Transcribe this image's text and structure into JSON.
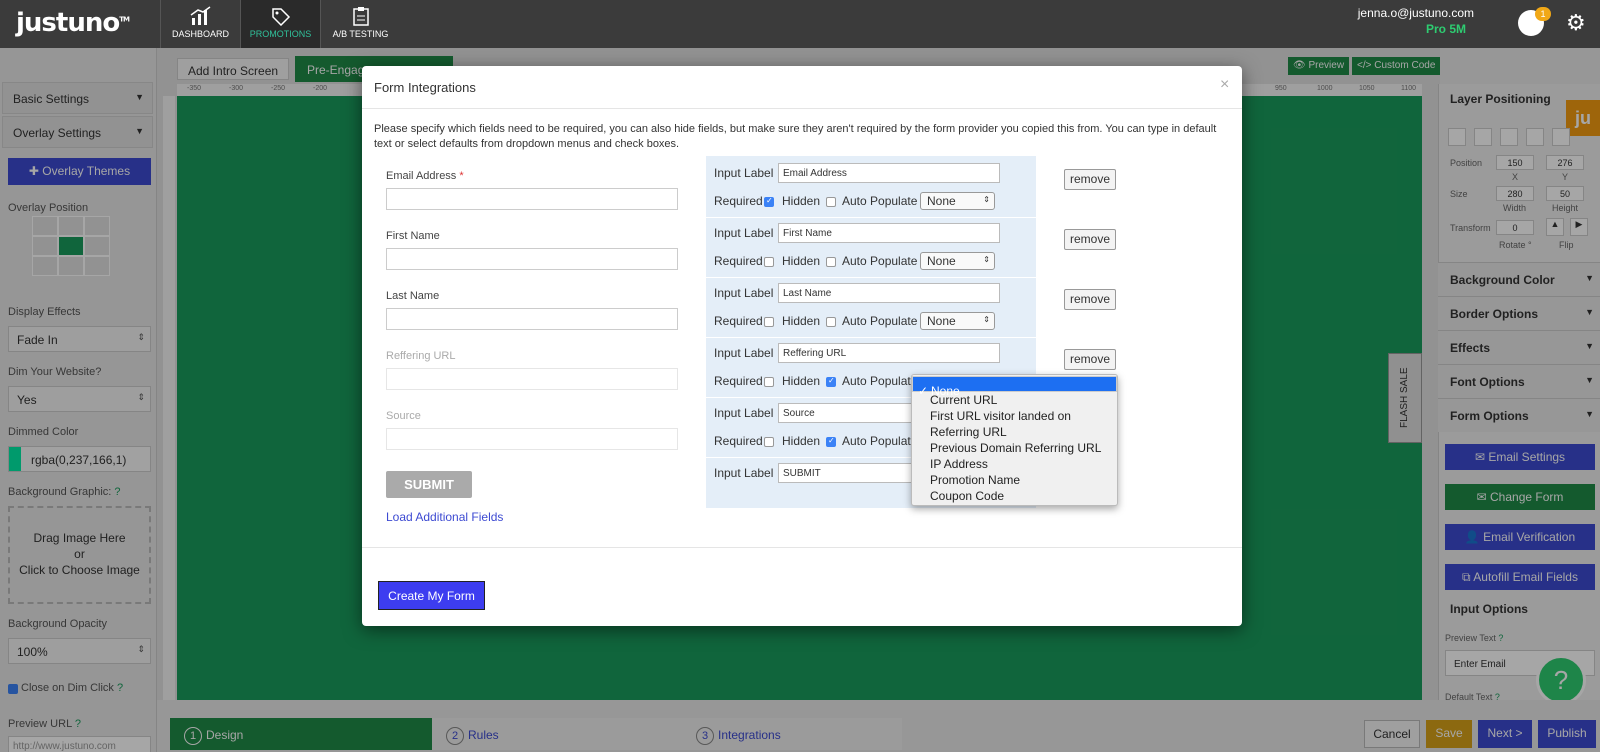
{
  "app": {
    "logo": "justuno",
    "logo_tm": "TM"
  },
  "nav": {
    "tabs": [
      {
        "label": "DASHBOARD"
      },
      {
        "label": "PROMOTIONS"
      },
      {
        "label": "A/B TESTING"
      }
    ]
  },
  "user": {
    "email": "jenna.o@justuno.com",
    "plan": "Pro 5M",
    "notifications": "1"
  },
  "left": {
    "basic_settings": "Basic Settings",
    "overlay_settings": "Overlay Settings",
    "overlay_themes": "Overlay Themes",
    "overlay_position": "Overlay Position",
    "display_effects_label": "Display Effects",
    "display_effects_value": "Fade In",
    "dim_label": "Dim Your Website?",
    "dim_value": "Yes",
    "dimmed_color_label": "Dimmed Color",
    "dimmed_color_value": "rgba(0,237,166,1)",
    "bg_graphic_label": "Background Graphic:",
    "drop_line1": "Drag Image Here",
    "drop_line2": "or",
    "drop_line3": "Click to Choose Image",
    "bg_opacity_label": "Background Opacity",
    "bg_opacity_value": "100%",
    "close_on_dim": "Close on Dim Click",
    "preview_url_label": "Preview URL",
    "preview_url_value": "http://www.justuno.com"
  },
  "editor": {
    "tab_intro": "Add Intro Screen",
    "tab_pre": "Pre-Engag",
    "preview_btn": "Preview",
    "custom_code_btn": "Custom Code",
    "flash_sale": "FLASH SALE",
    "ruler": [
      "-350",
      "-300",
      "-250",
      "-200",
      "950",
      "1000",
      "1050",
      "1100"
    ]
  },
  "right": {
    "layer_positioning": "Layer Positioning",
    "position_label": "Position",
    "pos_x": "150",
    "pos_y": "276",
    "x_lbl": "X",
    "y_lbl": "Y",
    "size_label": "Size",
    "width": "280",
    "height": "50",
    "w_lbl": "Width",
    "h_lbl": "Height",
    "transform_label": "Transform",
    "rotate": "0",
    "rotate_lbl": "Rotate °",
    "flip_lbl": "Flip",
    "background_color": "Background Color",
    "border_options": "Border Options",
    "effects": "Effects",
    "font_options": "Font Options",
    "form_options": "Form Options",
    "email_settings": "Email Settings",
    "change_form": "Change Form",
    "email_verification": "Email Verification",
    "autofill": "Autofill Email Fields",
    "input_options": "Input Options",
    "preview_text_label": "Preview Text",
    "preview_text_value": "Enter Email",
    "default_text_label": "Default Text",
    "ju": "ju"
  },
  "steps": [
    {
      "num": "1",
      "label": "Design"
    },
    {
      "num": "2",
      "label": "Rules"
    },
    {
      "num": "3",
      "label": "Integrations"
    }
  ],
  "actions": {
    "cancel": "Cancel",
    "save": "Save",
    "next": "Next >",
    "publish": "Publish"
  },
  "modal": {
    "title": "Form Integrations",
    "close": "×",
    "description": "Please specify which fields need to be required, you can also hide fields, but make sure they aren't required by the form provider you copied this from. You can type in default text or select defaults from dropdown menus and check boxes.",
    "fields": [
      {
        "label": "Email Address",
        "input_label": "Email Address",
        "required": true,
        "hidden": false,
        "auto": "None"
      },
      {
        "label": "First Name",
        "input_label": "First Name",
        "required": false,
        "hidden": false,
        "auto": "None"
      },
      {
        "label": "Last Name",
        "input_label": "Last Name",
        "required": false,
        "hidden": false,
        "auto": "None"
      },
      {
        "label": "Reffering URL",
        "input_label": "Reffering URL",
        "required": false,
        "hidden": true,
        "auto": ""
      },
      {
        "label": "Source",
        "input_label": "Source",
        "required": false,
        "hidden": true,
        "auto": ""
      }
    ],
    "submit_input_label": "SUBMIT",
    "input_label_text": "Input Label",
    "required_text": "Required",
    "hidden_text": "Hidden",
    "auto_text": "Auto Populate",
    "remove": "remove",
    "submit_btn": "SUBMIT",
    "load_more": "Load Additional Fields",
    "create": "Create My Form",
    "required_star": "*"
  },
  "dropdown": {
    "options": [
      "None",
      "Current URL",
      "First URL visitor landed on",
      "Referring URL",
      "Previous Domain Referring URL",
      "IP Address",
      "Promotion Name",
      "Coupon Code"
    ],
    "selected": "None",
    "check": "✓"
  },
  "colors": {
    "accent": "#3d4ad2",
    "green": "#1a9b5c",
    "dimmed": "#00eda6"
  }
}
